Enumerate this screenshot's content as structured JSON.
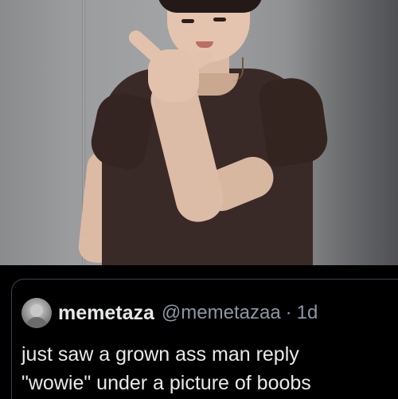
{
  "tweet": {
    "display_name": "memetaza",
    "handle": "@memetazaa",
    "separator": "·",
    "timestamp": "1d",
    "text_lines": [
      "just saw a grown ass man reply",
      "\"wowie\" under a picture of boobs"
    ]
  },
  "icons": {
    "avatar": "profile-avatar-image"
  },
  "colors": {
    "background": "#000000",
    "name_text": "#e7e9ea",
    "secondary_text": "#8b98a5",
    "card_border": "#38444d",
    "shirt": "#3a2a27"
  }
}
